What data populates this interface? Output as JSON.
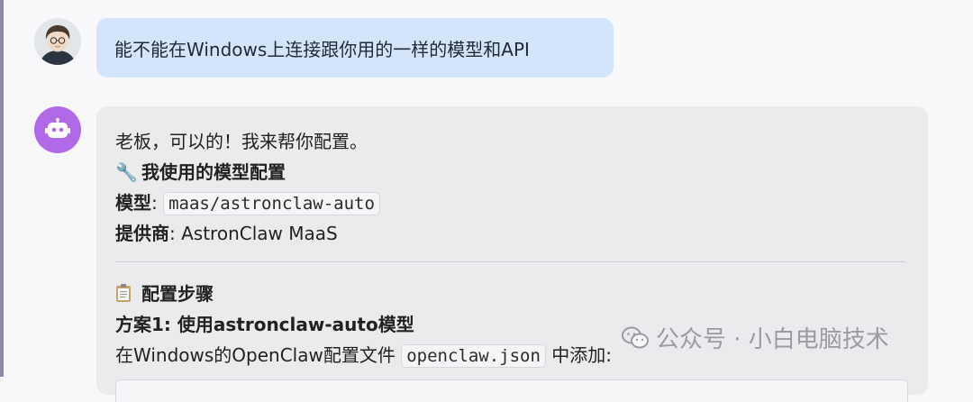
{
  "messages": {
    "user": {
      "avatar_icon": "user-photo-icon",
      "text": "能不能在Windows上连接跟你用的一样的模型和API"
    },
    "assistant": {
      "avatar_icon": "robot-icon",
      "greeting": "老板，可以的！我来帮你配置。",
      "section1_icon": "🔧",
      "section1_title": "我使用的模型配置",
      "model_label": "模型",
      "model_value": "maas/astronclaw-auto",
      "provider_label": "提供商",
      "provider_value": "AstronClaw MaaS",
      "section2_icon": "📋",
      "section2_title": "配置步骤",
      "plan1_title": "方案1: 使用astronclaw-auto模型",
      "step_prefix": "在Windows的OpenClaw配置文件",
      "step_file": "openclaw.json",
      "step_suffix": "中添加:"
    }
  },
  "watermark": {
    "icon": "wechat-icon",
    "text": "公众号 · 小白电脑技术"
  }
}
